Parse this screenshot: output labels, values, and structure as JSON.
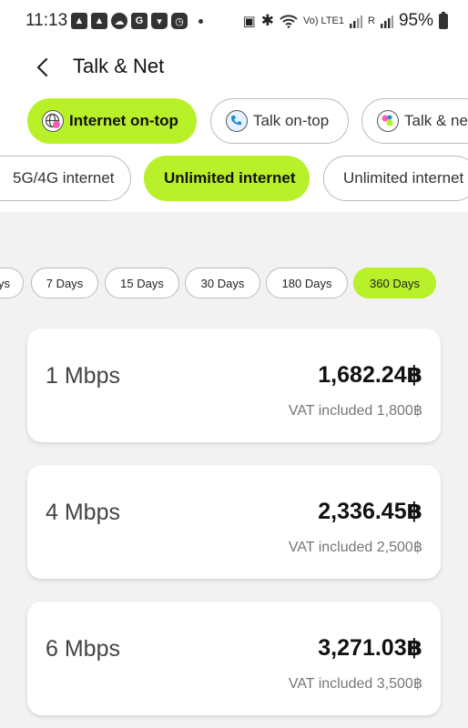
{
  "status_bar": {
    "time": "11:13",
    "battery": "95%",
    "network_label": "Vo) LTE1",
    "roaming_label": "R"
  },
  "header": {
    "title": "Talk & Net"
  },
  "categories": [
    {
      "label": "Internet on-top",
      "active": true
    },
    {
      "label": "Talk on-top",
      "active": false
    },
    {
      "label": "Talk & net",
      "active": false
    }
  ],
  "subcategories": [
    {
      "label": "5G/4G internet",
      "active": false
    },
    {
      "label": "Unlimited internet",
      "active": true
    },
    {
      "label": "Unlimited internet",
      "active": false
    }
  ],
  "durations": [
    {
      "label": "ys",
      "active": false
    },
    {
      "label": "7 Days",
      "active": false
    },
    {
      "label": "15 Days",
      "active": false
    },
    {
      "label": "30 Days",
      "active": false
    },
    {
      "label": "180 Days",
      "active": false
    },
    {
      "label": "360 Days",
      "active": true
    }
  ],
  "packages": [
    {
      "speed": "1 Mbps",
      "price": "1,682.24฿",
      "vat": "VAT included 1,800฿"
    },
    {
      "speed": "4 Mbps",
      "price": "2,336.45฿",
      "vat": "VAT included 2,500฿"
    },
    {
      "speed": "6 Mbps",
      "price": "3,271.03฿",
      "vat": "VAT included 3,500฿"
    }
  ],
  "colors": {
    "accent": "#b8f02a",
    "background": "#f2f2f2"
  }
}
